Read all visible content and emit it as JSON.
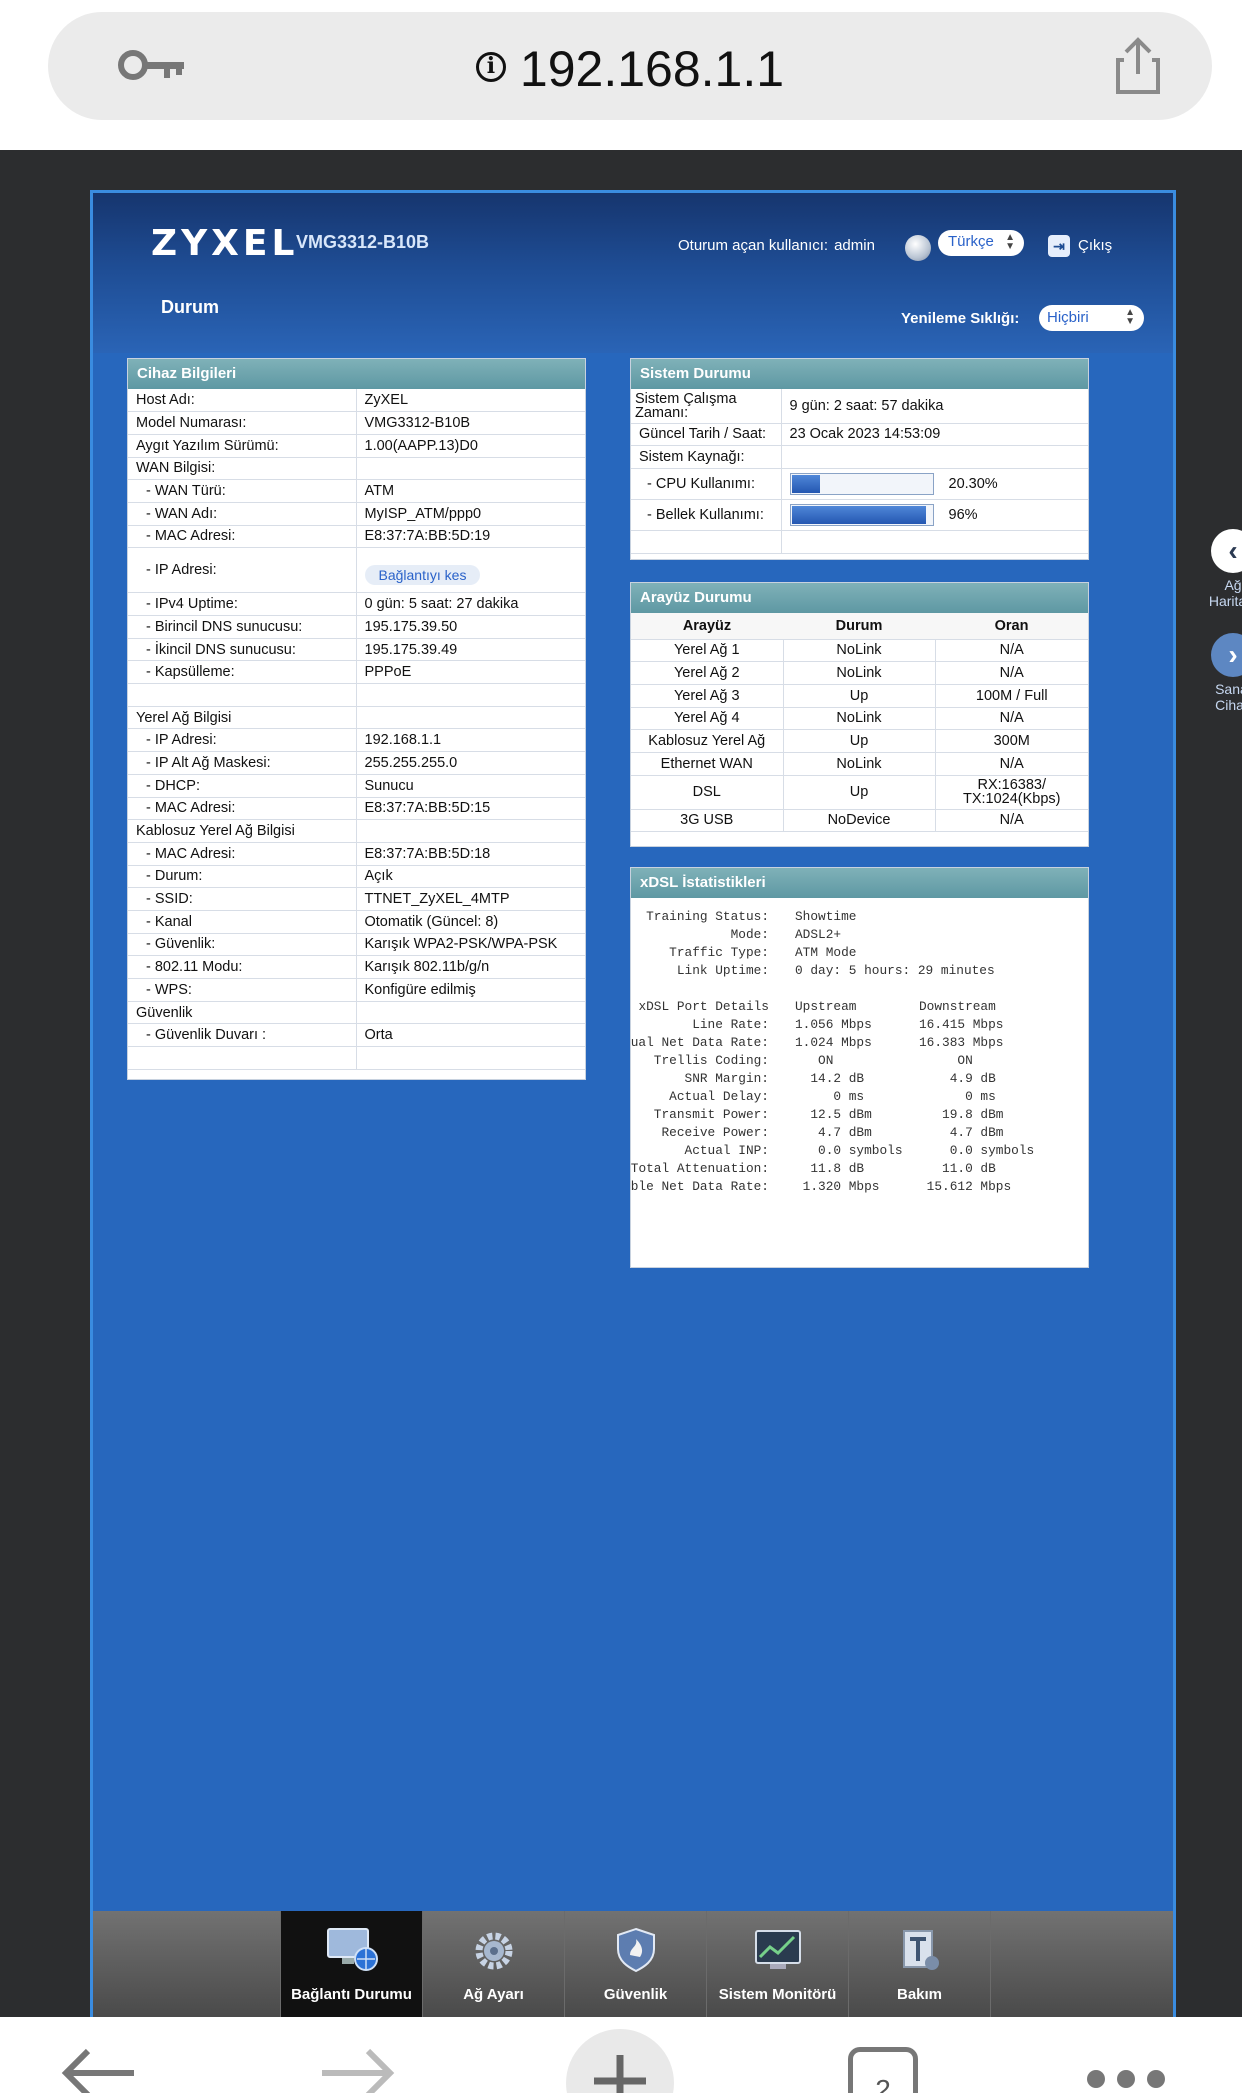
{
  "browser": {
    "url": "192.168.1.1",
    "tab_count": "2"
  },
  "header": {
    "brand": "ZYXEL",
    "model": "VMG3312-B10B",
    "login_label": "Oturum açan kullanıcı:",
    "login_user": "admin",
    "language": "Türkçe",
    "logout": "Çıkış",
    "page_title": "Durum",
    "refresh_label": "Yenileme Sıklığı:",
    "refresh_value": "Hiçbiri"
  },
  "device_info": {
    "title": "Cihaz Bilgileri",
    "rows": [
      {
        "k": "Host Adı:",
        "v": "ZyXEL"
      },
      {
        "k": "Model Numarası:",
        "v": "VMG3312-B10B"
      },
      {
        "k": "Aygıt Yazılım Sürümü:",
        "v": "1.00(AAPP.13)D0"
      },
      {
        "k": "WAN Bilgisi:",
        "v": ""
      },
      {
        "k": "- WAN Türü:",
        "v": "ATM"
      },
      {
        "k": "- WAN Adı:",
        "v": "MyISP_ATM/ppp0"
      },
      {
        "k": "- MAC Adresi:",
        "v": "E8:37:7A:BB:5D:19"
      },
      {
        "k": "- IP Adresi:",
        "v": "",
        "button": "Bağlantıyı kes"
      },
      {
        "k": "- IPv4 Uptime:",
        "v": "0 gün: 5 saat: 27 dakika"
      },
      {
        "k": "- Birincil DNS sunucusu:",
        "v": "195.175.39.50"
      },
      {
        "k": "- İkincil DNS sunucusu:",
        "v": "195.175.39.49"
      },
      {
        "k": "- Kapsülleme:",
        "v": "PPPoE"
      },
      {
        "k": "",
        "v": ""
      },
      {
        "k": "Yerel Ağ Bilgisi",
        "v": ""
      },
      {
        "k": "- IP Adresi:",
        "v": "192.168.1.1"
      },
      {
        "k": "- IP Alt Ağ Maskesi:",
        "v": "255.255.255.0"
      },
      {
        "k": "- DHCP:",
        "v": "Sunucu"
      },
      {
        "k": "- MAC Adresi:",
        "v": "E8:37:7A:BB:5D:15"
      },
      {
        "k": "Kablosuz Yerel Ağ Bilgisi",
        "v": ""
      },
      {
        "k": "- MAC Adresi:",
        "v": "E8:37:7A:BB:5D:18"
      },
      {
        "k": "- Durum:",
        "v": "Açık"
      },
      {
        "k": "- SSID:",
        "v": "TTNET_ZyXEL_4MTP"
      },
      {
        "k": "- Kanal",
        "v": "Otomatik (Güncel: 8)"
      },
      {
        "k": "- Güvenlik:",
        "v": "Karışık WPA2-PSK/WPA-PSK"
      },
      {
        "k": "- 802.11 Modu:",
        "v": "Karışık 802.11b/g/n"
      },
      {
        "k": "- WPS:",
        "v": "Konfigüre edilmiş"
      },
      {
        "k": "Güvenlik",
        "v": ""
      },
      {
        "k": "- Güvenlik Duvarı :",
        "v": "Orta"
      },
      {
        "k": "",
        "v": ""
      }
    ]
  },
  "system_status": {
    "title": "Sistem Durumu",
    "uptime_label": "Sistem Çalışma Zamanı:",
    "uptime_value": "9 gün: 2 saat: 57 dakika",
    "date_label": "Güncel Tarih / Saat:",
    "date_value": "23 Ocak 2023 14:53:09",
    "resources_label": "Sistem Kaynağı:",
    "cpu_label": "- CPU Kullanımı:",
    "cpu_value": "20.30%",
    "cpu_fraction": 0.203,
    "mem_label": "- Bellek Kullanımı:",
    "mem_value": "96%",
    "mem_fraction": 0.96
  },
  "interface_status": {
    "title": "Arayüz Durumu",
    "columns": [
      "Arayüz",
      "Durum",
      "Oran"
    ],
    "rows": [
      [
        "Yerel Ağ 1",
        "NoLink",
        "N/A"
      ],
      [
        "Yerel Ağ 2",
        "NoLink",
        "N/A"
      ],
      [
        "Yerel Ağ 3",
        "Up",
        "100M / Full"
      ],
      [
        "Yerel Ağ 4",
        "NoLink",
        "N/A"
      ],
      [
        "Kablosuz Yerel Ağ",
        "Up",
        "300M"
      ],
      [
        "Ethernet WAN",
        "NoLink",
        "N/A"
      ],
      [
        "DSL",
        "Up",
        "RX:16383/ TX:1024(Kbps)"
      ],
      [
        "3G USB",
        "NoDevice",
        "N/A"
      ]
    ]
  },
  "xdsl": {
    "title": "xDSL İstatistikleri",
    "rows": [
      {
        "l": "Training Status:",
        "a": "Showtime",
        "b": ""
      },
      {
        "l": "Mode:",
        "a": "ADSL2+",
        "b": ""
      },
      {
        "l": "Traffic Type:",
        "a": "ATM Mode",
        "b": ""
      },
      {
        "l": "Link Uptime:",
        "a": "0 day: 5 hours: 29 minutes",
        "b": ""
      },
      {
        "l": "",
        "a": "",
        "b": ""
      },
      {
        "l": "xDSL Port Details",
        "a": "Upstream",
        "b": "Downstream"
      },
      {
        "l": "Line Rate:",
        "a": "1.056 Mbps",
        "b": "16.415 Mbps"
      },
      {
        "l": "Actual Net Data Rate:",
        "a": "1.024 Mbps",
        "b": "16.383 Mbps"
      },
      {
        "l": "Trellis Coding:",
        "a": "   ON",
        "b": "     ON"
      },
      {
        "l": "SNR Margin:",
        "a": "  14.2 dB",
        "b": "    4.9 dB"
      },
      {
        "l": "Actual Delay:",
        "a": "     0 ms",
        "b": "      0 ms"
      },
      {
        "l": "Transmit Power:",
        "a": "  12.5 dBm",
        "b": "   19.8 dBm"
      },
      {
        "l": "Receive Power:",
        "a": "   4.7 dBm",
        "b": "    4.7 dBm"
      },
      {
        "l": "Actual INP:",
        "a": "   0.0 symbols",
        "b": "    0.0 symbols"
      },
      {
        "l": "Total Attenuation:",
        "a": "  11.8 dB",
        "b": "   11.0 dB"
      },
      {
        "l": "Attainable Net Data Rate:",
        "a": " 1.320 Mbps",
        "b": " 15.612 Mbps"
      }
    ]
  },
  "sidenav": {
    "network_map": "Ağ Haritası",
    "virtual_device": "Sanal Cihaz"
  },
  "bottomnav": {
    "items": [
      {
        "label": "Bağlantı Durumu"
      },
      {
        "label": "Ağ Ayarı"
      },
      {
        "label": "Güvenlik"
      },
      {
        "label": "Sistem Monitörü"
      },
      {
        "label": "Bakım"
      }
    ]
  }
}
